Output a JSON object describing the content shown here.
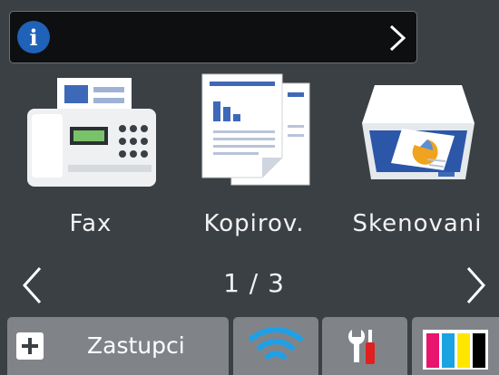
{
  "info_bar": {
    "icon": "info-icon",
    "icon_glyph": "i",
    "chevron": "chevron-right-icon"
  },
  "apps": [
    {
      "label": "Fax",
      "icon": "fax-icon"
    },
    {
      "label": "Kopirov.",
      "icon": "copy-icon"
    },
    {
      "label": "Skenovani",
      "icon": "scanner-icon"
    }
  ],
  "pager": {
    "text": "1 / 3",
    "prev_icon": "chevron-left-icon",
    "next_icon": "chevron-right-icon"
  },
  "bottom_bar": {
    "shortcuts": {
      "label": "Zastupci",
      "icon": "plus-icon"
    },
    "wifi": {
      "icon": "wifi-icon"
    },
    "settings": {
      "icon": "tools-icon"
    },
    "ink": {
      "icon": "ink-icon",
      "colors": [
        "#e8146e",
        "#1aa3e0",
        "#ffe600",
        "#000000"
      ]
    }
  },
  "colors": {
    "background": "#3b4045",
    "info_blue": "#1f62b8",
    "button": "#808489",
    "wifi_blue": "#1fa0e6",
    "tools_red": "#e02020"
  }
}
